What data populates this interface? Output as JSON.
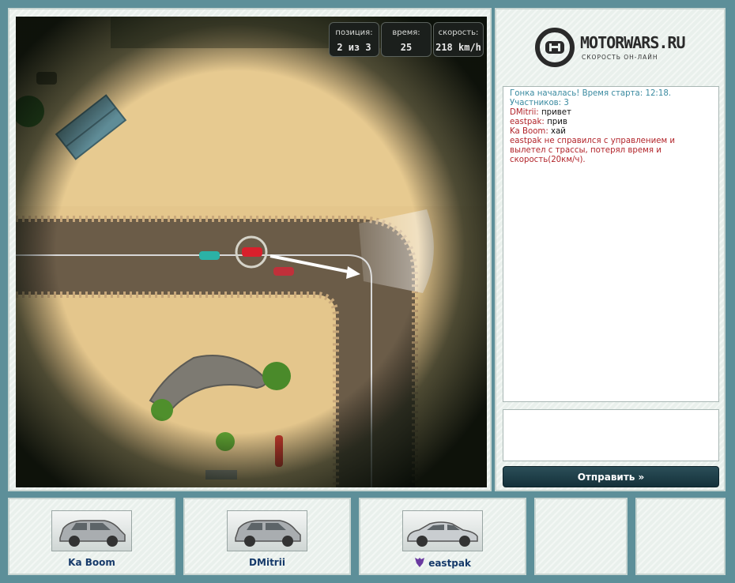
{
  "hud": {
    "position": {
      "label": "позиция:",
      "value": "2 из 3"
    },
    "time": {
      "label": "время:",
      "value": "25"
    },
    "speed": {
      "label": "скорость:",
      "value": "218 km/h"
    }
  },
  "logo": {
    "title": "MOTORWARS.RU",
    "subtitle": "СКОРОСТЬ ОН-ЛАЙН"
  },
  "chat": {
    "lines": [
      {
        "type": "system",
        "text": "Гонка началась! Время старта: 12:18. Участников: 3"
      },
      {
        "type": "message",
        "name": "DMitrii:",
        "text": " привет"
      },
      {
        "type": "message",
        "name": "eastpak:",
        "text": " прив"
      },
      {
        "type": "message",
        "name": "Ka Boom:",
        "text": " хай"
      },
      {
        "type": "warning",
        "text": "eastpak не справился с управлением и вылетел с трассы, потерял время и скорость(20км/ч)."
      }
    ]
  },
  "chat_input": {
    "value": ""
  },
  "send_button": {
    "label": "Отправить »"
  },
  "players": [
    {
      "name": "Ka Boom",
      "car": "suv-silver"
    },
    {
      "name": "DMitrii",
      "car": "suv-silver"
    },
    {
      "name": "eastpak",
      "car": "sedan-silver",
      "badge": "decepticon-icon"
    }
  ],
  "colors": {
    "background": "#5d8f99",
    "send_button": "#1f404a",
    "chat_system": "#3a8aa0",
    "chat_name": "#b2252b"
  }
}
